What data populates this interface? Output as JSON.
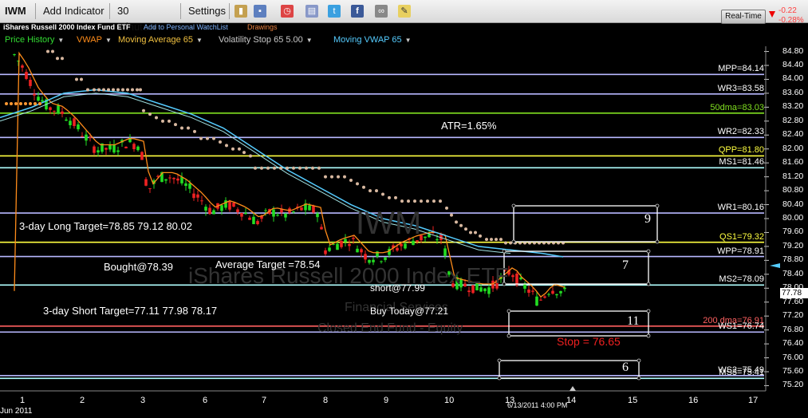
{
  "toolbar": {
    "symbol": "IWM",
    "add_indicator": "Add Indicator",
    "interval": "30 Minute",
    "settings": "Settings"
  },
  "subbar": {
    "security_name": "iShares Russell 2000 Index Fund ETF",
    "watchlist_link": "Add to Personal WatchList",
    "drawings": "Drawings"
  },
  "indicators": [
    {
      "label": "Price History",
      "color": "#33dd33"
    },
    {
      "label": "VWAP",
      "color": "#ff8c1a"
    },
    {
      "label": "Moving Average 65",
      "color": "#f0c040"
    },
    {
      "label": "Volatility Stop 65 5.00",
      "color": "#c8c8c8"
    },
    {
      "label": "Moving VWAP 65",
      "color": "#55ccff"
    }
  ],
  "realtime": {
    "button": "Real-Time",
    "change": "-0.22",
    "change_pct": "-0.28%"
  },
  "watermark": {
    "symbol": "IWM",
    "name": "iShares Russell 2000 Index ETF",
    "line1": "Financial Services",
    "line2": "Closed End Fund - Equity"
  },
  "annotations": {
    "atr": "ATR=1.65%",
    "long_target": "3-day Long Target=78.85 79.12 80.02",
    "bought": "Bought@78.39",
    "avg_target": "Average Target =78.54",
    "short": "short@77.99",
    "short_target": "3-day Short Target=77.11 77.98 78.17",
    "buy_today": "Buy Today@77.21",
    "stop": "Stop = 76.65",
    "box1": "9",
    "box2": "7",
    "box3": "11",
    "box4": "6"
  },
  "levels": [
    {
      "label": "MPP=84.14",
      "value": 84.14,
      "color": "#b8b8ff",
      "text_color": "#ffffff"
    },
    {
      "label": "WR3=83.58",
      "value": 83.58,
      "color": "#b8b8ff",
      "text_color": "#ffffff"
    },
    {
      "label": "50dma=83.03",
      "value": 83.03,
      "color": "#80e020",
      "text_color": "#80e020"
    },
    {
      "label": "WR2=82.33",
      "value": 82.33,
      "color": "#b8b8ff",
      "text_color": "#ffffff"
    },
    {
      "label": "QPP=81.80",
      "value": 81.8,
      "color": "#ffff40",
      "text_color": "#ffff40"
    },
    {
      "label": "MS1=81.46",
      "value": 81.46,
      "color": "#b0ffff",
      "text_color": "#ffffff"
    },
    {
      "label": "WR1=80.16",
      "value": 80.16,
      "color": "#b8b8ff",
      "text_color": "#ffffff"
    },
    {
      "label": "QS1=79.32",
      "value": 79.32,
      "color": "#ffff40",
      "text_color": "#ffff40"
    },
    {
      "label": "WPP=78.91",
      "value": 78.91,
      "color": "#b8b8ff",
      "text_color": "#ffffff"
    },
    {
      "label": "MS2=78.09",
      "value": 78.09,
      "color": "#b0ffff",
      "text_color": "#ffffff"
    },
    {
      "label": "200 dma=76.91",
      "value": 76.91,
      "color": "#ff6060",
      "text_color": "#ff6060"
    },
    {
      "label": "WS1=76.74",
      "value": 76.74,
      "color": "#b8b8ff",
      "text_color": "#ffffff"
    },
    {
      "label": "WS2=75.49",
      "value": 75.49,
      "color": "#b8b8ff",
      "text_color": "#ffffff"
    },
    {
      "label": "MS3=75.41",
      "value": 75.41,
      "color": "#b0ffff",
      "text_color": "#ffffff"
    }
  ],
  "y_ticks": [
    "84.80",
    "84.40",
    "84.00",
    "83.60",
    "83.20",
    "82.80",
    "82.40",
    "82.00",
    "81.60",
    "81.20",
    "80.80",
    "80.40",
    "80.00",
    "79.60",
    "79.20",
    "78.80",
    "78.40",
    "78.00",
    "77.60",
    "77.20",
    "76.80",
    "76.40",
    "76.00",
    "75.60",
    "75.20"
  ],
  "last_price": "77.78",
  "x_ticks": [
    "1",
    "2",
    "3",
    "6",
    "7",
    "8",
    "9",
    "10",
    "13",
    "14",
    "15",
    "16",
    "17"
  ],
  "x_period": "Jun 2011",
  "cursor_time": "6/13/2011 4:00 PM",
  "colors": {
    "up": "#22dd22",
    "down": "#ee2222",
    "vwap": "#ff8c1a",
    "mvwap": "#55ccff",
    "vstop": "#d8b8a0"
  },
  "chart_data": {
    "type": "candlestick",
    "ylim": [
      75.0,
      85.0
    ],
    "x_ticks": [
      "1",
      "2",
      "3",
      "6",
      "7",
      "8",
      "9",
      "10",
      "13",
      "14",
      "15",
      "16",
      "17"
    ],
    "close_approx": [
      84.6,
      84.1,
      83.8,
      83.4,
      83.1,
      82.8,
      82.5,
      82.3,
      82.1,
      81.6,
      81.3,
      81.0,
      80.6,
      80.4,
      80.2,
      80.0,
      79.8,
      79.6,
      79.3,
      79.1,
      79.0,
      78.9,
      78.6,
      78.2,
      77.9,
      77.8,
      77.5,
      77.6,
      77.78
    ]
  }
}
